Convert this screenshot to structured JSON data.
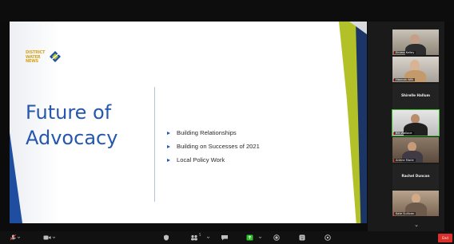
{
  "slide": {
    "logo_text": "DISTRICT WATER NEWS",
    "logo_sub": "",
    "title_line1": "Future of",
    "title_line2": "Advocacy",
    "bullets": [
      "Building Relationships",
      "Building on Successes of 2021",
      "Local Policy Work"
    ]
  },
  "participants": [
    {
      "name": "Emma Kelley",
      "type": "video"
    },
    {
      "name": "Hannah Wilt",
      "type": "video"
    },
    {
      "name": "Shirelle Hallum",
      "type": "name"
    },
    {
      "name": "Bill Wallace",
      "type": "video",
      "active": true
    },
    {
      "name": "Arlene Marie",
      "type": "video"
    },
    {
      "name": "Rachel Duncan",
      "type": "name"
    },
    {
      "name": "Kate Sullivan",
      "type": "video"
    }
  ],
  "toolbar": {
    "items": [
      "mute-icon",
      "video-icon",
      "security-icon",
      "participants-icon",
      "chat-icon",
      "share-screen-icon",
      "record-icon",
      "reactions-icon",
      "apps-icon"
    ],
    "participants_count": "5",
    "end_label": "End"
  },
  "colors": {
    "accent_blue": "#2557ac",
    "accent_green": "#b3c129",
    "navy": "#1b3566",
    "end_red": "#d9302c"
  }
}
